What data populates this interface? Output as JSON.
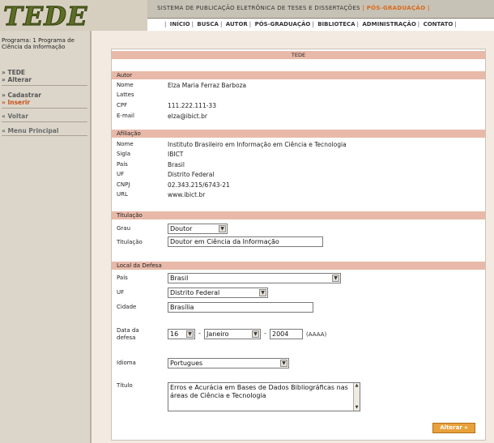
{
  "header": {
    "logo": "TEDE",
    "title_main": "SISTEMA DE PUBLICAÇÃO ELETRÔNICA DE TESES E DISSERTAÇÕES",
    "title_sep": "|",
    "title_accent": "PÓS-GRADUAÇÃO",
    "title_end": "|",
    "nav": [
      "INÍCIO",
      "BUSCA",
      "AUTOR",
      "PÓS-GRADUAÇÃO",
      "BIBLIOTECA",
      "ADMINISTRAÇÃO",
      "CONTATO"
    ]
  },
  "sidebar": {
    "program": "Programa: 1 Programa de Ciência da Informação",
    "tede": "» TEDE",
    "alterar": "» Alterar",
    "cadastrar": "» Cadastrar",
    "inserir": "» Inserir",
    "voltar": "« Voltar",
    "menu_principal": "« Menu Principal"
  },
  "panel": {
    "title": "TEDE",
    "autor": {
      "heading": "Autor",
      "rows": [
        {
          "label": "Nome",
          "value": "Elza Maria Ferraz Barboza"
        },
        {
          "label": "Lattes",
          "value": ""
        },
        {
          "label": "CPF",
          "value": "111.222.111-33"
        },
        {
          "label": "E-mail",
          "value": "elza@ibict.br"
        }
      ]
    },
    "afiliacao": {
      "heading": "Afiliação",
      "rows": [
        {
          "label": "Nome",
          "value": "Instituto Brasileiro em Informação em Ciência e Tecnologia"
        },
        {
          "label": "Sigla",
          "value": "IBICT"
        },
        {
          "label": "País",
          "value": "Brasil"
        },
        {
          "label": "UF",
          "value": "Distrito Federal"
        },
        {
          "label": "CNPJ",
          "value": "02.343.215/6743-21"
        },
        {
          "label": "URL",
          "value": "www.ibict.br"
        }
      ]
    },
    "titulacao": {
      "heading": "Titulação",
      "grau_label": "Grau",
      "grau_value": "Doutor",
      "titulacao_label": "Titulação",
      "titulacao_value": "Doutor em Ciência da Informação"
    },
    "local_defesa": {
      "heading": "Local da Defesa",
      "pais_label": "País",
      "pais_value": "Brasil",
      "uf_label": "UF",
      "uf_value": "Distrito Federal",
      "cidade_label": "Cidade",
      "cidade_value": "Brasília",
      "data_label": "Data da defesa",
      "dia": "16",
      "mes": "Janeiro",
      "ano": "2004",
      "ano_format": "(AAAA)",
      "dash": "-",
      "idioma_label": "Idioma",
      "idioma_value": "Portugues",
      "titulo_label": "Título",
      "titulo_value": "Erros e Acurácia em Bases de Dados Bibliográficas nas áreas de Ciência e Tecnologia"
    },
    "alterar_button": "Alterar »"
  },
  "colors": {
    "section_bar": "#e8b9a9",
    "accent_orange": "#d9691c",
    "button": "#e8a13a",
    "sidebar_bg": "#dcd6ca",
    "content_bg": "#f3ebe2"
  }
}
